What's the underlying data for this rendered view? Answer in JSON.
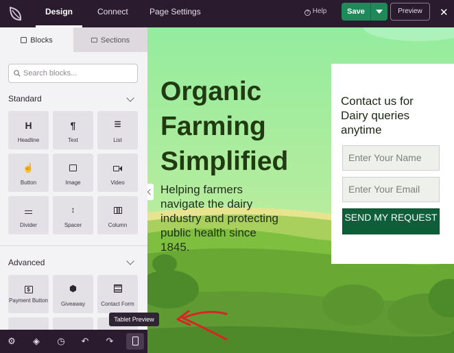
{
  "topbar": {
    "tabs": [
      {
        "label": "Design",
        "active": true
      },
      {
        "label": "Connect",
        "active": false
      },
      {
        "label": "Page Settings",
        "active": false
      }
    ],
    "help_label": "Help",
    "save_label": "Save",
    "preview_label": "Preview",
    "close_icon": "close-icon"
  },
  "sidebar": {
    "tabs": [
      {
        "label": "Blocks",
        "icon": "blocks-icon",
        "active": true
      },
      {
        "label": "Sections",
        "icon": "sections-icon",
        "active": false
      }
    ],
    "search_placeholder": "Search blocks...",
    "sections": [
      {
        "title": "Standard",
        "blocks": [
          {
            "label": "Headline",
            "icon": "H"
          },
          {
            "label": "Text",
            "icon": "¶"
          },
          {
            "label": "List",
            "icon": "list-icon"
          },
          {
            "label": "Button",
            "icon": "pointer-icon"
          },
          {
            "label": "Image",
            "icon": "image-icon"
          },
          {
            "label": "Video",
            "icon": "video-icon"
          },
          {
            "label": "Divider",
            "icon": "divider-icon"
          },
          {
            "label": "Spacer",
            "icon": "spacer-icon"
          },
          {
            "label": "Column",
            "icon": "column-icon"
          }
        ]
      },
      {
        "title": "Advanced",
        "blocks": [
          {
            "label": "Payment Button",
            "icon": "dollar-icon"
          },
          {
            "label": "Giveaway",
            "icon": "trophy-icon"
          },
          {
            "label": "Contact Form",
            "icon": "form-icon"
          }
        ]
      }
    ]
  },
  "bottombar": {
    "icons": [
      "gear-icon",
      "layers-icon",
      "history-icon",
      "undo-icon",
      "redo-icon",
      "tablet-icon"
    ],
    "tooltip": "Tablet Preview"
  },
  "page": {
    "headline": "Organic Farming Simplified",
    "subheadline": "Helping farmers navigate the dairy industry and protecting public health since 1845.",
    "form": {
      "title": "Contact us for Dairy queries anytime",
      "name_placeholder": "Enter Your Name",
      "email_placeholder": "Enter Your Email",
      "submit_label": "SEND MY REQUEST"
    }
  },
  "colors": {
    "topbar": "#2a1b2e",
    "save": "#1e8a5a",
    "submit": "#0f5e3a",
    "headline": "#203a12"
  }
}
